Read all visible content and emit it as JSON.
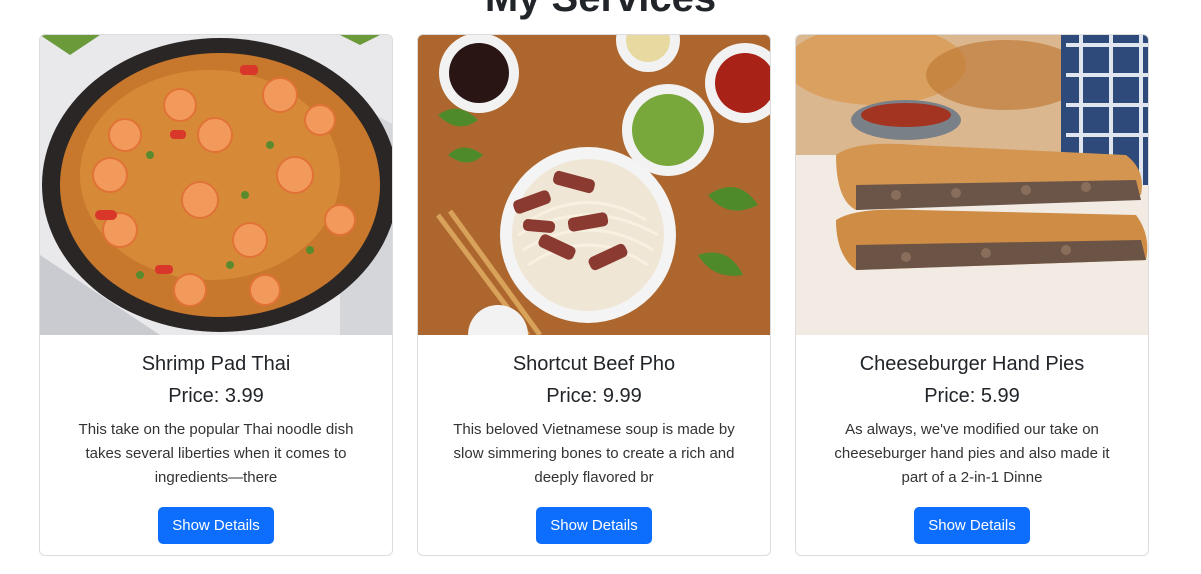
{
  "section": {
    "title": "My Services"
  },
  "services": [
    {
      "name": "Shrimp Pad Thai",
      "price": "Price: 3.99",
      "description": "This take on the popular Thai noodle dish takes several liberties when it comes to ingredients—there",
      "button_label": "Show Details"
    },
    {
      "name": "Shortcut Beef Pho",
      "price": "Price: 9.99",
      "description": "This beloved Vietnamese soup is made by slow simmering bones to create a rich and deeply flavored br",
      "button_label": "Show Details"
    },
    {
      "name": "Cheeseburger Hand Pies",
      "price": "Price: 5.99",
      "description": "As always, we've modified our take on cheeseburger hand pies and also made it part of a 2-in-1 Dinne",
      "button_label": "Show Details"
    }
  ],
  "colors": {
    "button": "#0d6efd",
    "card_border": "#dcdcdc"
  }
}
